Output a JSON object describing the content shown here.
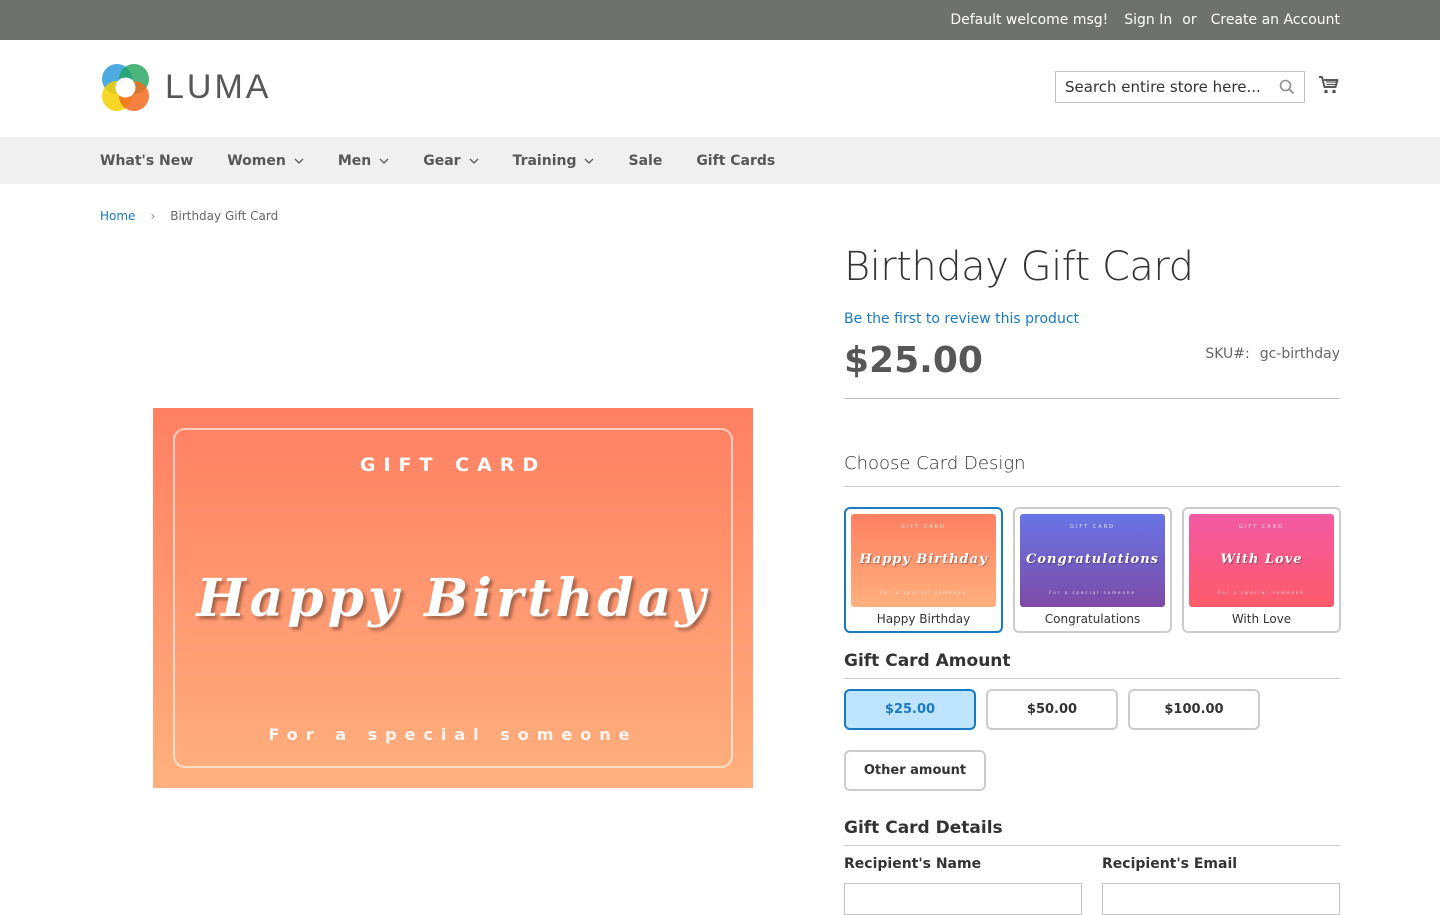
{
  "topbar": {
    "welcome": "Default welcome msg!",
    "sign_in": "Sign In",
    "or": "or",
    "create_account": "Create an Account"
  },
  "header": {
    "logo_text": "LUMA",
    "search_placeholder": "Search entire store here..."
  },
  "nav": {
    "items": [
      {
        "label": "What's New",
        "has_dropdown": false
      },
      {
        "label": "Women",
        "has_dropdown": true
      },
      {
        "label": "Men",
        "has_dropdown": true
      },
      {
        "label": "Gear",
        "has_dropdown": true
      },
      {
        "label": "Training",
        "has_dropdown": true
      },
      {
        "label": "Sale",
        "has_dropdown": false
      },
      {
        "label": "Gift Cards",
        "has_dropdown": false
      }
    ]
  },
  "breadcrumb": {
    "home": "Home",
    "current": "Birthday Gift Card"
  },
  "gallery": {
    "top_text": "GIFT CARD",
    "main_text": "Happy Birthday",
    "bottom_text": "For a special someone"
  },
  "product": {
    "title": "Birthday Gift Card",
    "review_link": "Be the first to review this product",
    "price": "$25.00",
    "sku_label": "SKU#:",
    "sku_value": "gc-birthday"
  },
  "design_section": {
    "title": "Choose Card Design",
    "designs": [
      {
        "label": "Happy Birthday",
        "thumb_main": "Happy Birthday",
        "thumb_top": "GIFT CARD",
        "thumb_bottom": "For a special someone",
        "selected": true,
        "color_top": "#ff7f62",
        "color_bottom": "#ffb07e"
      },
      {
        "label": "Congratulations",
        "thumb_main": "Congratulations",
        "thumb_top": "GIFT CARD",
        "thumb_bottom": "For a special someone",
        "selected": false,
        "color_top": "#6875e6",
        "color_bottom": "#7d4ba6"
      },
      {
        "label": "With Love",
        "thumb_main": "With Love",
        "thumb_top": "GIFT CARD",
        "thumb_bottom": "For a special someone",
        "selected": false,
        "color_top": "#f25aa3",
        "color_bottom": "#ff5b6a"
      }
    ]
  },
  "amount_section": {
    "title": "Gift Card Amount",
    "amounts": [
      {
        "label": "$25.00",
        "selected": true
      },
      {
        "label": "$50.00",
        "selected": false
      },
      {
        "label": "$100.00",
        "selected": false
      }
    ],
    "other_label": "Other amount"
  },
  "details_section": {
    "title": "Gift Card Details",
    "recipient_name_label": "Recipient's Name",
    "recipient_email_label": "Recipient's Email"
  },
  "colors": {
    "link": "#1979c3",
    "topbar_bg": "#6e716e",
    "nav_bg": "#f0f0f0",
    "selected_amount_bg": "#bfe4ff"
  }
}
